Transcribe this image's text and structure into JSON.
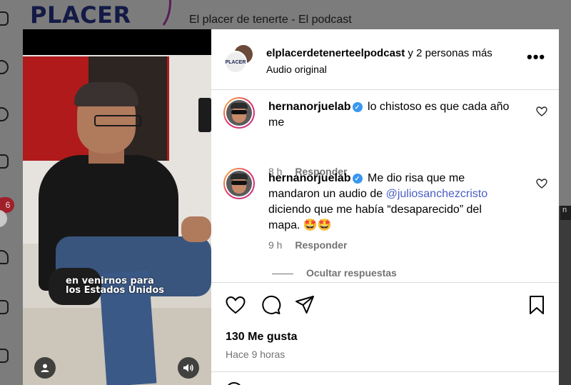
{
  "background": {
    "logo_text": "PLACER",
    "page_title": "El placer de tenerte - El podcast",
    "notification_count": "6"
  },
  "video": {
    "caption_line1": "en venirnos para",
    "caption_line2": "los Estados Unidos"
  },
  "post": {
    "author": "elplacerdetenerteelpodcast",
    "coauthors": "y 2 personas más",
    "audio": "Audio original",
    "avatar_text": "PLACER"
  },
  "comments": [
    {
      "user": "hernanorjuelab",
      "text": "lo chistoso es que cada año me",
      "time": "8 h",
      "reply_label": "Responder"
    },
    {
      "user": "hernanorjuelab",
      "text_before": "Me dio risa que me mandaron un audio de ",
      "mention": "@juliosanchezcristo",
      "text_after": " diciendo que me había “desaparecido” del mapa. 🤩🤩",
      "time": "9 h",
      "reply_label": "Responder"
    }
  ],
  "hide_replies_label": "Ocultar respuestas",
  "likes_label": "130 Me gusta",
  "posted_time": "Hace 9 horas",
  "colors": {
    "verified": "#3897f0",
    "mention": "#4a5ec4",
    "muted": "#737373"
  }
}
